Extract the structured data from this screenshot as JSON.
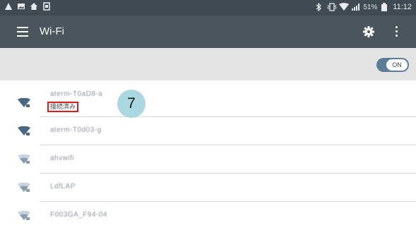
{
  "status_bar": {
    "battery": "51%",
    "time": "11:12",
    "left_icons": [
      "warning-icon",
      "image-icon",
      "home-icon",
      "sd-card-icon"
    ],
    "right_icons": [
      "bluetooth-icon",
      "vibrate-icon",
      "wifi-icon",
      "signal-icon",
      "battery-icon"
    ]
  },
  "app_bar": {
    "title": "Wi-Fi",
    "icons": [
      "menu-icon",
      "gear-icon",
      "more-vert-icon"
    ]
  },
  "wifi_toggle": {
    "label": "ON",
    "state": "on"
  },
  "networks": [
    {
      "ssid": "aterm-T0aD8-a",
      "status": "接続済み",
      "secured": true,
      "signal": "full"
    },
    {
      "ssid": "aterm-T0d03-g",
      "secured": true,
      "signal": "full"
    },
    {
      "ssid": "ahvwifi",
      "secured": true,
      "signal": "medium"
    },
    {
      "ssid": "LdfLAP",
      "secured": true,
      "signal": "medium"
    },
    {
      "ssid": "F003GA_F94-04",
      "secured": true,
      "signal": "medium"
    }
  ],
  "annotation": {
    "label": "7"
  },
  "colors": {
    "status_bar": "#3f4a52",
    "app_bar": "#4a555d",
    "toggle_bar": "#e4e4e4",
    "toggle_on": "#5c7d98",
    "wifi_strong": "#4b6680",
    "wifi_weak": "#8a9cb0",
    "highlight_box": "#d61f1f",
    "annotation_badge": "#a9d8e0"
  }
}
